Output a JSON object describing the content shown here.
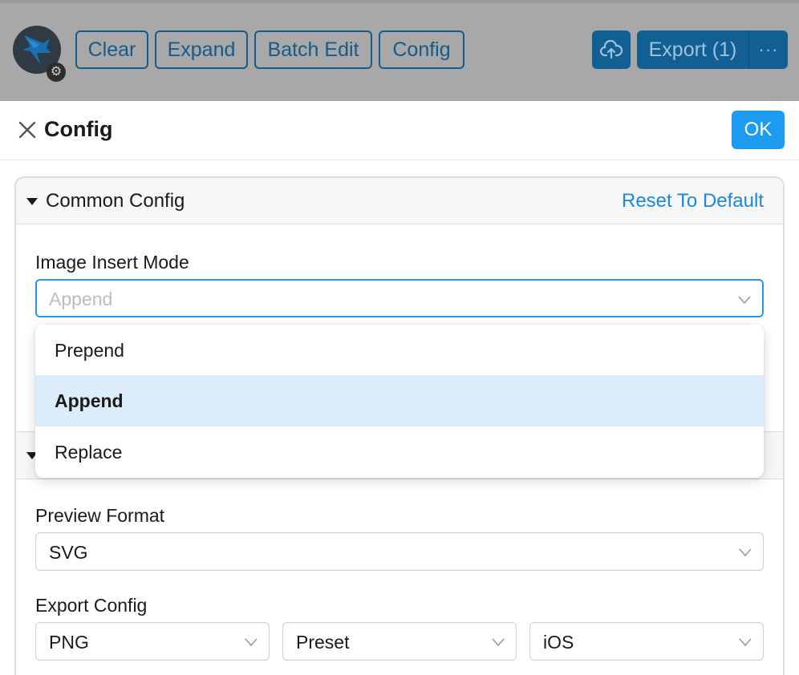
{
  "toolbar": {
    "clear_label": "Clear",
    "expand_label": "Expand",
    "batch_edit_label": "Batch Edit",
    "config_label": "Config",
    "upload_icon": "cloud-upload-icon",
    "export_label": "Export (1)",
    "more_label": "···"
  },
  "modal": {
    "title": "Config",
    "ok_label": "OK",
    "close_icon": "close-icon"
  },
  "common_config": {
    "title": "Common Config",
    "reset_label": "Reset To Default",
    "image_insert_mode_label": "Image Insert Mode",
    "image_insert_mode_placeholder": "Append"
  },
  "dropdown": {
    "options": [
      {
        "label": "Prepend",
        "selected": false
      },
      {
        "label": "Append",
        "selected": true
      },
      {
        "label": "Replace",
        "selected": false
      }
    ]
  },
  "section2": {
    "preview_format_label": "Preview Format",
    "preview_format_value": "SVG",
    "export_config_label": "Export Config",
    "export_format_value": "PNG",
    "export_preset_value": "Preset",
    "export_platform_value": "iOS"
  },
  "colors": {
    "accent": "#1c9bf0",
    "link": "#1888e0",
    "selected_option_bg": "#dcecfb",
    "toolbar_overlay": "#a8a8a8"
  }
}
